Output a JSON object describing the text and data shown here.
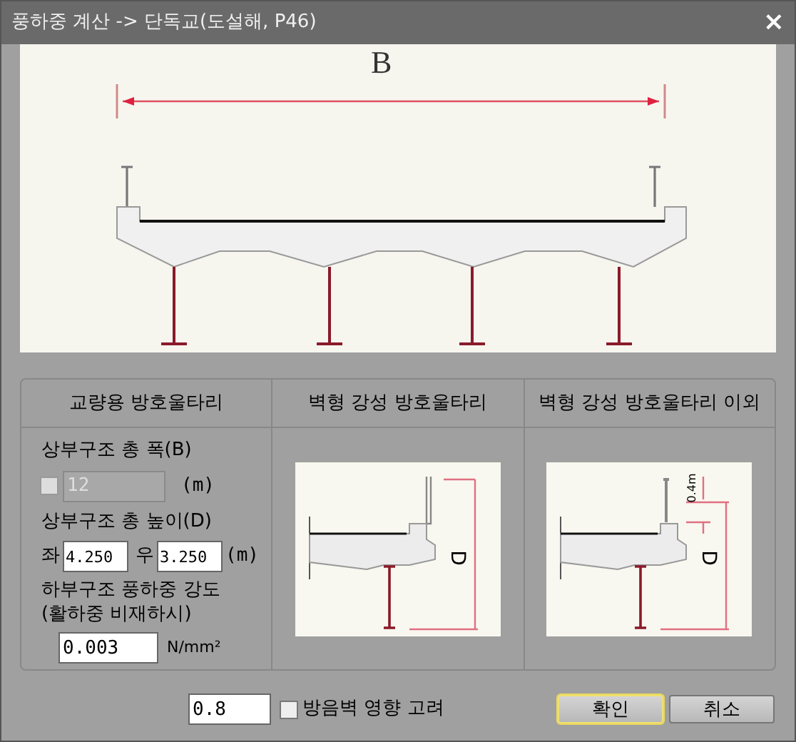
{
  "window": {
    "title": "풍하중 계산 -> 단독교(도설해, P46)",
    "close": "×"
  },
  "diagram": {
    "width_label": "B"
  },
  "guardrail_panel": {
    "heading": "교량용 방호울타리",
    "width_label": "상부구조 총 폭(B)",
    "width_checkbox": {
      "checked": false
    },
    "width_field": {
      "value": "12",
      "disabled": true
    },
    "width_unit": "(m)",
    "height_label": "상부구조 총 높이(D)",
    "left_label": "좌",
    "left_value": "4.250",
    "right_label": "우",
    "right_value": "3.250",
    "height_unit": "(m)",
    "strength_lines": [
      "하부구조 풍하중 강도",
      "(활하중 비재하시)"
    ],
    "strength_value": "0.003",
    "strength_unit": "N/mm²"
  },
  "wall_panels": [
    {
      "heading": "벽형 강성 방호울타리",
      "kind": "wall",
      "depth_label": "D"
    },
    {
      "heading": "벽형 강성 방호울타리 이외",
      "kind": "post",
      "depth_label": "D",
      "offset_label": "0.4m"
    }
  ],
  "factor_value": "0.8",
  "noise_wall": {
    "label": "방음벽 영향 고려",
    "checked": false
  },
  "buttons": [
    {
      "label": "확인",
      "focused": true
    },
    {
      "label": "취소",
      "focused": false
    }
  ]
}
